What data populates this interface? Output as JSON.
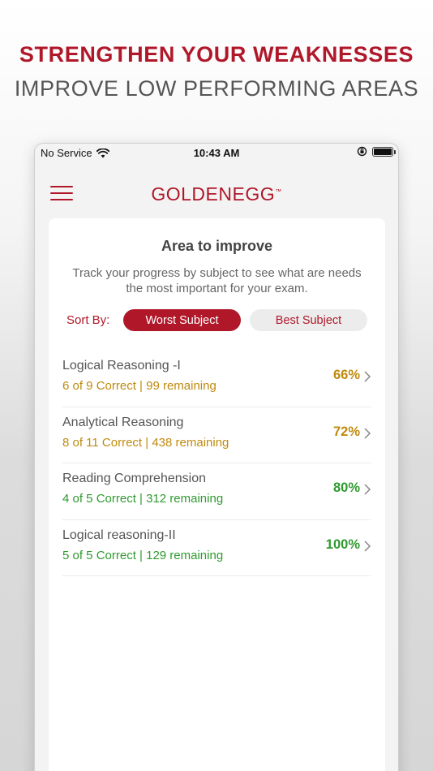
{
  "promo": {
    "headline": "STRENGTHEN YOUR WEAKNESSES",
    "subline": "IMPROVE LOW PERFORMING AREAS"
  },
  "status_bar": {
    "carrier": "No Service",
    "time": "10:43 AM"
  },
  "app": {
    "logo_text": "GOLDENEGG",
    "logo_mark": "™"
  },
  "card": {
    "title": "Area to improve",
    "description": "Track your progress by subject to see what are needs the most important for your exam.",
    "sort_label": "Sort By:",
    "sort_options": [
      "Worst Subject",
      "Best Subject"
    ],
    "selected_sort": "Worst Subject"
  },
  "subjects": [
    {
      "name": "Logical Reasoning -I",
      "detail": "6 of 9  Correct | 99 remaining",
      "percent": "66%",
      "status": "warning"
    },
    {
      "name": "Analytical Reasoning",
      "detail": "8 of 11  Correct | 438 remaining",
      "percent": "72%",
      "status": "warning"
    },
    {
      "name": "Reading Comprehension",
      "detail": "4 of 5  Correct | 312 remaining",
      "percent": "80%",
      "status": "good"
    },
    {
      "name": "Logical reasoning-II",
      "detail": "5 of 5  Correct | 129 remaining",
      "percent": "100%",
      "status": "good"
    }
  ],
  "colors": {
    "brand_red": "#b0182a",
    "warning_gold": "#c08a0e",
    "good_green": "#2f9a2f",
    "dark_gray": "#555555"
  },
  "icons": {
    "wifi": "wifi-icon",
    "orientation_lock": "orientation-lock-icon",
    "battery": "battery-icon",
    "menu": "hamburger-menu-icon",
    "chevron": "chevron-right-icon"
  }
}
